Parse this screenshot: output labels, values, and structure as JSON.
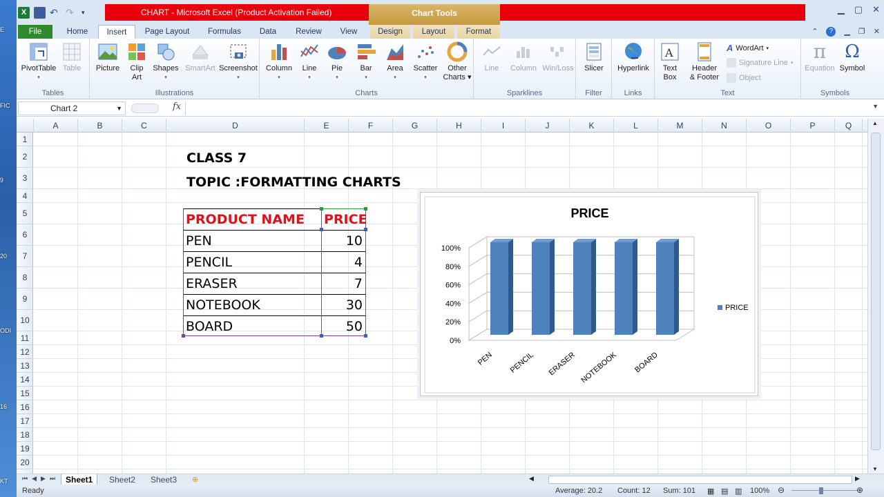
{
  "window": {
    "title": "CHART  -  Microsoft Excel (Product Activation Failed)",
    "contextual_tab_group": "Chart Tools"
  },
  "ribbon_tabs": [
    "File",
    "Home",
    "Insert",
    "Page Layout",
    "Formulas",
    "Data",
    "Review",
    "View",
    "Design",
    "Layout",
    "Format"
  ],
  "active_tab": "Insert",
  "ribbon": {
    "tables": {
      "label": "Tables",
      "pivottable": "PivotTable",
      "table": "Table"
    },
    "illustrations": {
      "label": "Illustrations",
      "picture": "Picture",
      "clip_art_1": "Clip",
      "clip_art_2": "Art",
      "shapes": "Shapes",
      "smartart": "SmartArt",
      "screenshot": "Screenshot"
    },
    "charts": {
      "label": "Charts",
      "column": "Column",
      "line": "Line",
      "pie": "Pie",
      "bar": "Bar",
      "area": "Area",
      "scatter": "Scatter",
      "other_1": "Other",
      "other_2": "Charts"
    },
    "sparklines": {
      "label": "Sparklines",
      "line": "Line",
      "column": "Column",
      "winloss": "Win/Loss"
    },
    "filter": {
      "label": "Filter",
      "slicer": "Slicer"
    },
    "links": {
      "label": "Links",
      "hyperlink": "Hyperlink"
    },
    "text": {
      "label": "Text",
      "textbox_1": "Text",
      "textbox_2": "Box",
      "header_1": "Header",
      "header_2": "& Footer",
      "wordart": "WordArt",
      "signature": "Signature Line",
      "object": "Object"
    },
    "symbols": {
      "label": "Symbols",
      "equation": "Equation",
      "symbol": "Symbol"
    }
  },
  "formula_bar": {
    "name_box": "Chart 2",
    "fx": "fx",
    "formula": ""
  },
  "columns": [
    "A",
    "B",
    "C",
    "D",
    "E",
    "F",
    "G",
    "H",
    "I",
    "J",
    "K",
    "L",
    "M",
    "N",
    "O",
    "P",
    "Q"
  ],
  "rows": [
    "1",
    "2",
    "3",
    "4",
    "5",
    "6",
    "7",
    "8",
    "9",
    "10",
    "11",
    "12",
    "13",
    "14",
    "15",
    "16",
    "17",
    "18",
    "19",
    "20"
  ],
  "sheet": {
    "heading1": "CLASS 7",
    "heading2": "TOPIC :FORMATTING CHARTS",
    "table_header": {
      "name": "PRODUCT NAME",
      "price": "PRICE"
    },
    "table_rows": [
      {
        "name": "PEN",
        "price": "10"
      },
      {
        "name": "PENCIL",
        "price": "4"
      },
      {
        "name": "ERASER",
        "price": "7"
      },
      {
        "name": "NOTEBOOK",
        "price": "30"
      },
      {
        "name": "BOARD",
        "price": "50"
      }
    ]
  },
  "chart_data": {
    "type": "bar",
    "title": "PRICE",
    "categories": [
      "PEN",
      "PENCIL",
      "ERASER",
      "NOTEBOOK",
      "BOARD"
    ],
    "series": [
      {
        "name": "PRICE",
        "values": [
          100,
          100,
          100,
          100,
          100
        ],
        "color": "#4f81bd"
      }
    ],
    "y_tick_labels": [
      "0%",
      "20%",
      "40%",
      "60%",
      "80%",
      "100%"
    ],
    "ylim": [
      0,
      100
    ],
    "legend": "right",
    "grid": true
  },
  "sheet_tabs": [
    "Sheet1",
    "Sheet2",
    "Sheet3"
  ],
  "active_sheet": "Sheet1",
  "status": {
    "mode": "Ready",
    "average": "Average: 20.2",
    "count": "Count: 12",
    "sum": "Sum: 101",
    "zoom": "100%"
  },
  "colors": {
    "accent_red": "#e8000a",
    "file_tab": "#2d8a2d",
    "header_text_red": "#e3101a",
    "chart_tools": "#c89a3e"
  }
}
